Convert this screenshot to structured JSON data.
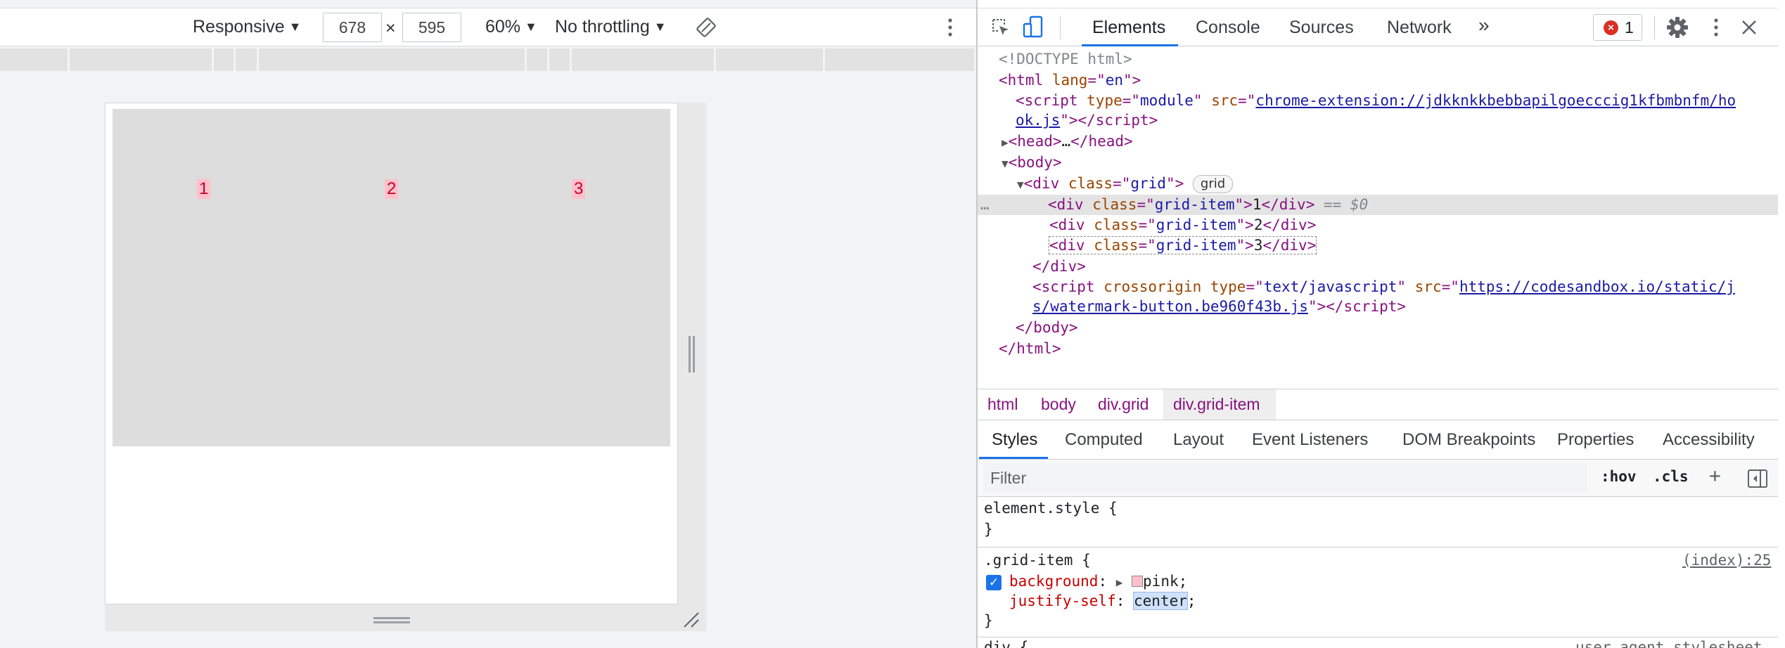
{
  "device_toolbar": {
    "device": "Responsive",
    "width": "678",
    "times": "×",
    "height": "595",
    "zoom": "60%",
    "throttling": "No throttling"
  },
  "viewport": {
    "grid_items": [
      "1",
      "2",
      "3"
    ]
  },
  "devtools_tabs": {
    "elements": "Elements",
    "console": "Console",
    "sources": "Sources",
    "network": "Network",
    "more": "»",
    "error_count": "1"
  },
  "dom": {
    "doctype": "<!DOCTYPE html>",
    "html_lang": "en",
    "script1_type": "module",
    "script1_src_a": "chrome-extension://jdkknkkbebbapilgoecccig1kfbmbnfm/ho",
    "script1_src_b": "ok.js",
    "head_ellipsis": "…",
    "div_class": "grid",
    "grid_badge": "grid",
    "item_class": "grid-item",
    "item1": "1",
    "item2": "2",
    "item3": "3",
    "selected_marker": "== $0",
    "script2_type": "text/javascript",
    "script2_src_a": "https://codesandbox.io/static/j",
    "script2_src_b": "s/watermark-button.be960f43b.js",
    "dots": "…"
  },
  "breadcrumb": [
    "html",
    "body",
    "div.grid",
    "div.grid-item"
  ],
  "styles_tabs": [
    "Styles",
    "Computed",
    "Layout",
    "Event Listeners",
    "DOM Breakpoints",
    "Properties",
    "Accessibility"
  ],
  "styles": {
    "filter_placeholder": "Filter",
    "hov": ":hov",
    "cls": ".cls",
    "plus": "+",
    "element_style": "element.style {",
    "close_brace": "}",
    "rule_selector": ".grid-item {",
    "rule_source": "(index):25",
    "prop1_name": "background",
    "prop1_value": "pink",
    "prop2_name": "justify-self",
    "prop2_value": "center",
    "next_selector": "div {",
    "next_source": "user agent stylesheet"
  },
  "colors": {
    "accent": "#1a73e8",
    "error": "#d93025",
    "pink": "#ffc0cb",
    "grid_bg": "#dddddd"
  }
}
